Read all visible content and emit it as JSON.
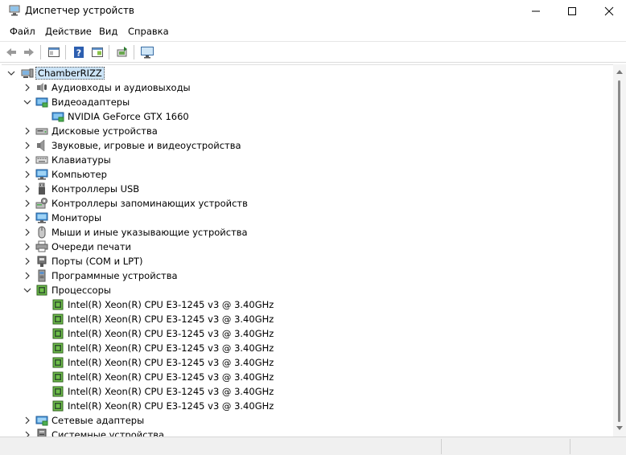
{
  "window": {
    "title": "Диспетчер устройств"
  },
  "menu": [
    "Файл",
    "Действие",
    "Вид",
    "Справка"
  ],
  "tree": {
    "root": "ChamberRIZZ",
    "items": [
      {
        "label": "Аудиовходы и аудиовыходы",
        "level": 1,
        "expanded": false,
        "icon": "speaker-mic-icon"
      },
      {
        "label": "Видеоадаптеры",
        "level": 1,
        "expanded": true,
        "icon": "display-adapter-icon"
      },
      {
        "label": "NVIDIA GeForce GTX 1660",
        "level": 2,
        "icon": "display-adapter-icon"
      },
      {
        "label": "Дисковые устройства",
        "level": 1,
        "expanded": false,
        "icon": "disk-drive-icon"
      },
      {
        "label": "Звуковые, игровые и видеоустройства",
        "level": 1,
        "expanded": false,
        "icon": "speaker-icon"
      },
      {
        "label": "Клавиатуры",
        "level": 1,
        "expanded": false,
        "icon": "keyboard-icon"
      },
      {
        "label": "Компьютер",
        "level": 1,
        "expanded": false,
        "icon": "computer-icon"
      },
      {
        "label": "Контроллеры USB",
        "level": 1,
        "expanded": false,
        "icon": "usb-icon"
      },
      {
        "label": "Контроллеры запоминающих устройств",
        "level": 1,
        "expanded": false,
        "icon": "storage-controller-icon"
      },
      {
        "label": "Мониторы",
        "level": 1,
        "expanded": false,
        "icon": "monitor-icon"
      },
      {
        "label": "Мыши и иные указывающие устройства",
        "level": 1,
        "expanded": false,
        "icon": "mouse-icon"
      },
      {
        "label": "Очереди печати",
        "level": 1,
        "expanded": false,
        "icon": "printer-icon"
      },
      {
        "label": "Порты (COM и LPT)",
        "level": 1,
        "expanded": false,
        "icon": "port-icon"
      },
      {
        "label": "Программные устройства",
        "level": 1,
        "expanded": false,
        "icon": "software-device-icon"
      },
      {
        "label": "Процессоры",
        "level": 1,
        "expanded": true,
        "icon": "processor-icon"
      },
      {
        "label": "Intel(R) Xeon(R) CPU E3-1245 v3 @ 3.40GHz",
        "level": 2,
        "icon": "processor-icon"
      },
      {
        "label": "Intel(R) Xeon(R) CPU E3-1245 v3 @ 3.40GHz",
        "level": 2,
        "icon": "processor-icon"
      },
      {
        "label": "Intel(R) Xeon(R) CPU E3-1245 v3 @ 3.40GHz",
        "level": 2,
        "icon": "processor-icon"
      },
      {
        "label": "Intel(R) Xeon(R) CPU E3-1245 v3 @ 3.40GHz",
        "level": 2,
        "icon": "processor-icon"
      },
      {
        "label": "Intel(R) Xeon(R) CPU E3-1245 v3 @ 3.40GHz",
        "level": 2,
        "icon": "processor-icon"
      },
      {
        "label": "Intel(R) Xeon(R) CPU E3-1245 v3 @ 3.40GHz",
        "level": 2,
        "icon": "processor-icon"
      },
      {
        "label": "Intel(R) Xeon(R) CPU E3-1245 v3 @ 3.40GHz",
        "level": 2,
        "icon": "processor-icon"
      },
      {
        "label": "Intel(R) Xeon(R) CPU E3-1245 v3 @ 3.40GHz",
        "level": 2,
        "icon": "processor-icon"
      },
      {
        "label": "Сетевые адаптеры",
        "level": 1,
        "expanded": false,
        "icon": "network-adapter-icon"
      },
      {
        "label": "Системные устройства",
        "level": 1,
        "expanded": false,
        "icon": "system-device-icon"
      }
    ]
  },
  "colors": {
    "selection": "#cce4f7",
    "accent": "#0078d4"
  }
}
